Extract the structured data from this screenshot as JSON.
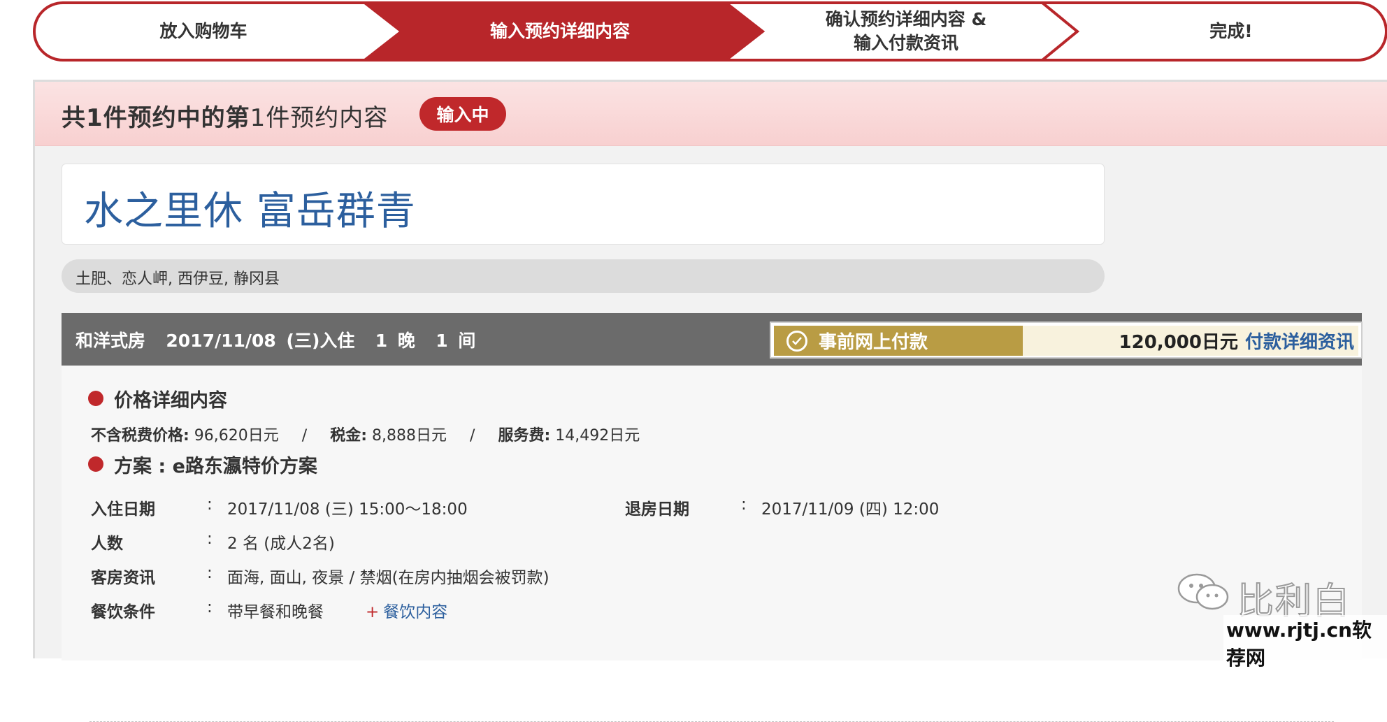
{
  "steps": [
    {
      "label_line1": "放入购物车",
      "label_line2": ""
    },
    {
      "label_line1": "输入预约详细内容",
      "label_line2": ""
    },
    {
      "label_line1": "确认预约详细内容 &",
      "label_line2": "输入付款资讯"
    },
    {
      "label_line1": "完成!",
      "label_line2": ""
    }
  ],
  "colors": {
    "accent": "#b8262a",
    "link": "#2c5f9e",
    "pay_gold": "#b99c44"
  },
  "booking": {
    "title_bold_1": "共1件预约中的第",
    "title_num": "1",
    "title_rest": "件预约内容",
    "status": "输入中"
  },
  "hotel": {
    "name": "水之里休 富岳群青",
    "address": "土肥、恋人岬, 西伊豆, 静冈县"
  },
  "room": {
    "summary": "和洋式房  2017/11/08 (三)入住  1 晚  1 间"
  },
  "payment": {
    "method": "事前网上付款",
    "amount": "120,000日元",
    "details_link": "付款详细资讯"
  },
  "price_details": {
    "title": "价格详细内容",
    "pre_tax_label": "不含税费价格:",
    "pre_tax_value": " 96,620日元",
    "tax_label": "税金:",
    "tax_value": " 8,888日元",
    "service_label": "服务费:",
    "service_value": " 14,492日元",
    "separator": "/"
  },
  "plan": {
    "title": "方案 : e路东瀛特价方案",
    "checkin_label": "入住日期",
    "checkin_value": "2017/11/08 (三) 15:00～18:00",
    "checkout_label": "退房日期",
    "checkout_value": "2017/11/09 (四) 12:00",
    "guests_label": "人数",
    "guests_value": "2 名 (成人2名)",
    "room_info_label": "客房资讯",
    "room_info_value": "面海, 面山, 夜景 / 禁烟(在房内抽烟会被罚款)",
    "meal_label": "餐饮条件",
    "meal_value": "带早餐和晚餐",
    "meal_link_plus": "+",
    "meal_link": "餐饮内容",
    "colon": ":"
  },
  "watermark": {
    "name": "比利白",
    "site": "www.rjtj.cn软荐网"
  }
}
